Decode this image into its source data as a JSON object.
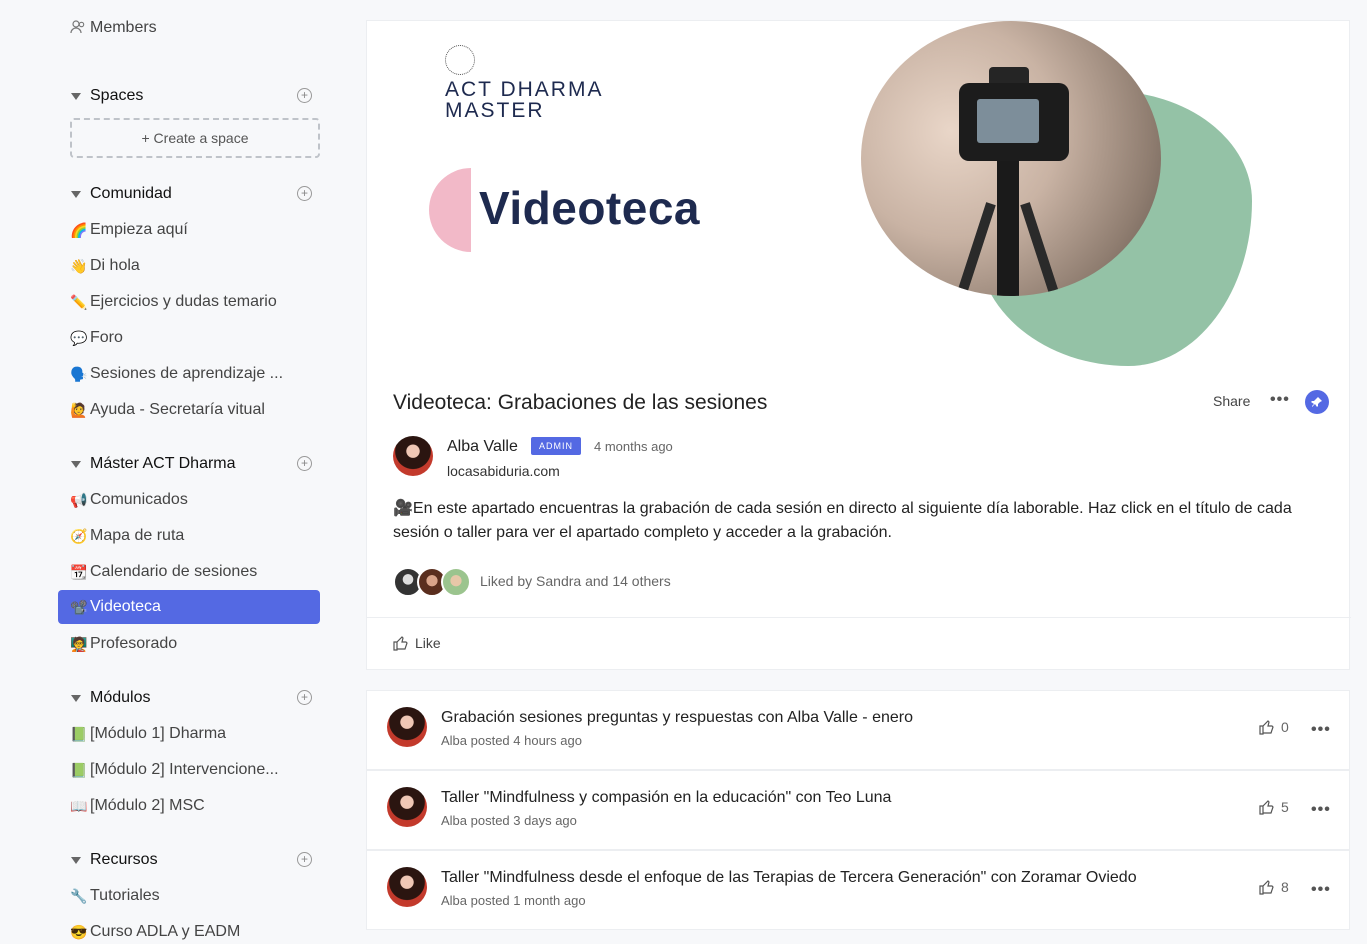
{
  "sidebar": {
    "members": {
      "icon": "members-icon",
      "label": "Members"
    },
    "sections": [
      {
        "title": "Spaces",
        "create_space": "+ Create a space",
        "items": []
      },
      {
        "title": "Comunidad",
        "items": [
          {
            "icon": "🌈",
            "label": "Empieza aquí"
          },
          {
            "icon": "👋",
            "label": "Di hola"
          },
          {
            "icon": "✏️",
            "label": "Ejercicios y dudas temario"
          },
          {
            "icon": "💬",
            "label": "Foro"
          },
          {
            "icon": "🗣️",
            "label": "Sesiones de aprendizaje ..."
          },
          {
            "icon": "🙋",
            "label": "Ayuda - Secretaría vitual"
          }
        ]
      },
      {
        "title": "Máster ACT Dharma",
        "items": [
          {
            "icon": "📢",
            "label": "Comunicados"
          },
          {
            "icon": "🧭",
            "label": "Mapa de ruta"
          },
          {
            "icon": "📆",
            "label": "Calendario de sesiones"
          },
          {
            "icon": "📽️",
            "label": "Videoteca",
            "active": true
          },
          {
            "icon": "🧑‍🏫",
            "label": "Profesorado"
          }
        ]
      },
      {
        "title": "Módulos",
        "items": [
          {
            "icon": "📗",
            "label": "[Módulo 1] Dharma"
          },
          {
            "icon": "📗",
            "label": "[Módulo 2] Intervencione..."
          },
          {
            "icon": "📖",
            "label": "[Módulo 2] MSC"
          }
        ]
      },
      {
        "title": "Recursos",
        "items": [
          {
            "icon": "🔧",
            "label": "Tutoriales"
          },
          {
            "icon": "😎",
            "label": "Curso ADLA y EADM"
          }
        ]
      }
    ]
  },
  "banner": {
    "brand_line1": "ACT DHARMA",
    "brand_line2": "MASTER",
    "title": "Videoteca",
    "colors": {
      "navy": "#1e2a4f",
      "pink": "#f2b9c8",
      "green": "#94c2a6"
    }
  },
  "post": {
    "title": "Videoteca: Grabaciones de las sesiones",
    "share_label": "Share",
    "more_label": "•••",
    "pin_icon": "pin-icon",
    "author": "Alba Valle",
    "badge": "ADMIN",
    "time_ago": "4 months ago",
    "website": "locasabiduria.com",
    "body": "🎥En este apartado encuentras la grabación de cada sesión en directo al siguiente día laborable. Haz click en el título de cada sesión o taller para ver el apartado completo y acceder a la grabación.",
    "liked_by": "Liked by Sandra and 14 others",
    "like_label": "Like"
  },
  "feed": [
    {
      "title": "Grabación sesiones preguntas y respuestas con Alba Valle - enero",
      "meta": "Alba posted 4 hours ago",
      "likes": "0"
    },
    {
      "title": "Taller \"Mindfulness y compasión en la educación\" con Teo Luna",
      "meta": "Alba posted 3 days ago",
      "likes": "5"
    },
    {
      "title": "Taller \"Mindfulness desde el enfoque de las Terapias de Tercera Generación\" con Zoramar Oviedo",
      "meta": "Alba posted 1 month ago",
      "likes": "8"
    }
  ],
  "accent_color": "#5469e3"
}
